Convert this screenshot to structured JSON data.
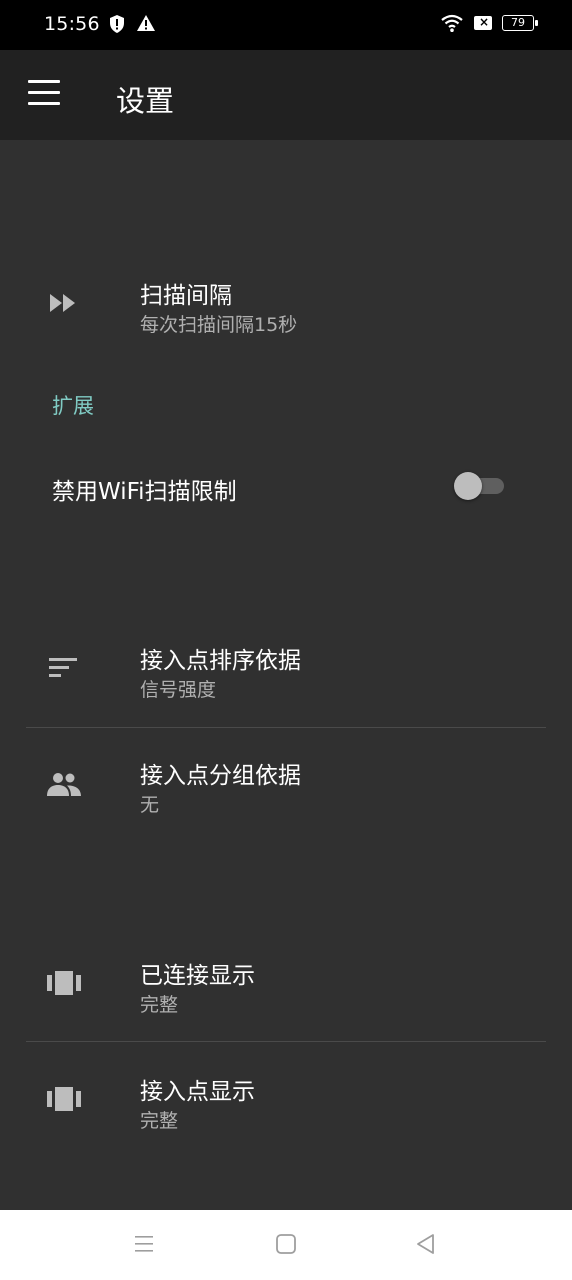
{
  "status_bar": {
    "time": "15:56",
    "battery": "79",
    "icons": [
      "shield-alert-icon",
      "warning-icon",
      "wifi-icon",
      "sim-x-icon",
      "battery-icon"
    ]
  },
  "app_bar": {
    "title": "设置",
    "menu_icon": "hamburger-menu-icon"
  },
  "settings": {
    "scan_interval": {
      "title": "扫描间隔",
      "summary": "每次扫描间隔15秒",
      "icon": "fast-forward-icon"
    },
    "extension_header": "扩展",
    "disable_wifi_throttle": {
      "title": "禁用WiFi扫描限制",
      "enabled": false
    },
    "sort_by": {
      "title": "接入点排序依据",
      "summary": "信号强度",
      "icon": "sort-icon"
    },
    "group_by": {
      "title": "接入点分组依据",
      "summary": "无",
      "icon": "group-icon"
    },
    "connected_display": {
      "title": "已连接显示",
      "summary": "完整",
      "icon": "view-carousel-icon"
    },
    "ap_display": {
      "title": "接入点显示",
      "summary": "完整",
      "icon": "view-carousel-icon"
    }
  },
  "nav_bar": {
    "buttons": [
      "recent-apps-icon",
      "home-icon",
      "back-icon"
    ]
  },
  "colors": {
    "background": "#303030",
    "app_bar": "#212121",
    "accent": "#80cbc4",
    "secondary_text": "#b0b0b0"
  }
}
